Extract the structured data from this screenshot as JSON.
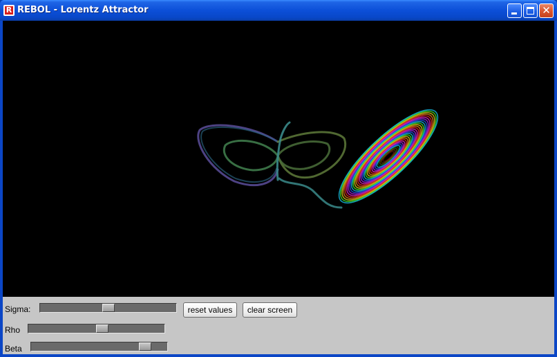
{
  "window": {
    "title": "REBOL - Lorentz Attractor",
    "icon_letter": "R",
    "icon_color": "#d8201c",
    "controls": {
      "minimize": "minimize-icon",
      "maximize": "maximize-icon",
      "close": "close-icon",
      "close_glyph": "✕"
    }
  },
  "canvas": {
    "background": "#000000",
    "content": "lorentz-attractor-trace"
  },
  "controls": {
    "sigma": {
      "label": "Sigma:",
      "value_fraction": 0.5
    },
    "rho": {
      "label": "Rho",
      "value_fraction": 0.55
    },
    "beta": {
      "label": "Beta",
      "value_fraction": 0.87
    },
    "reset_button": "reset values",
    "clear_button": "clear screen"
  }
}
